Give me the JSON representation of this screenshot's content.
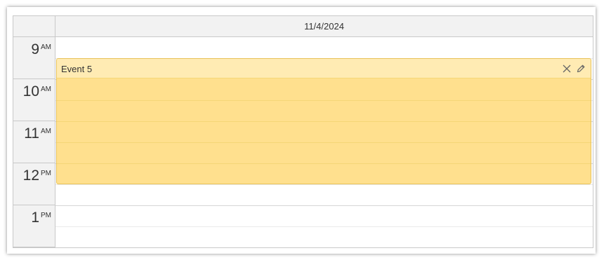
{
  "calendar": {
    "column_header": "11/4/2024",
    "hours": [
      {
        "number": "9",
        "ampm": "AM"
      },
      {
        "number": "10",
        "ampm": "AM"
      },
      {
        "number": "11",
        "ampm": "AM"
      },
      {
        "number": "12",
        "ampm": "PM"
      },
      {
        "number": "1",
        "ampm": "PM"
      }
    ]
  },
  "event": {
    "title": "Event 5",
    "delete_icon": "close-icon",
    "edit_icon": "pencil-icon",
    "color_fill": "#ffe08e",
    "color_header": "#ffebb3",
    "color_border": "#e8c35a"
  }
}
